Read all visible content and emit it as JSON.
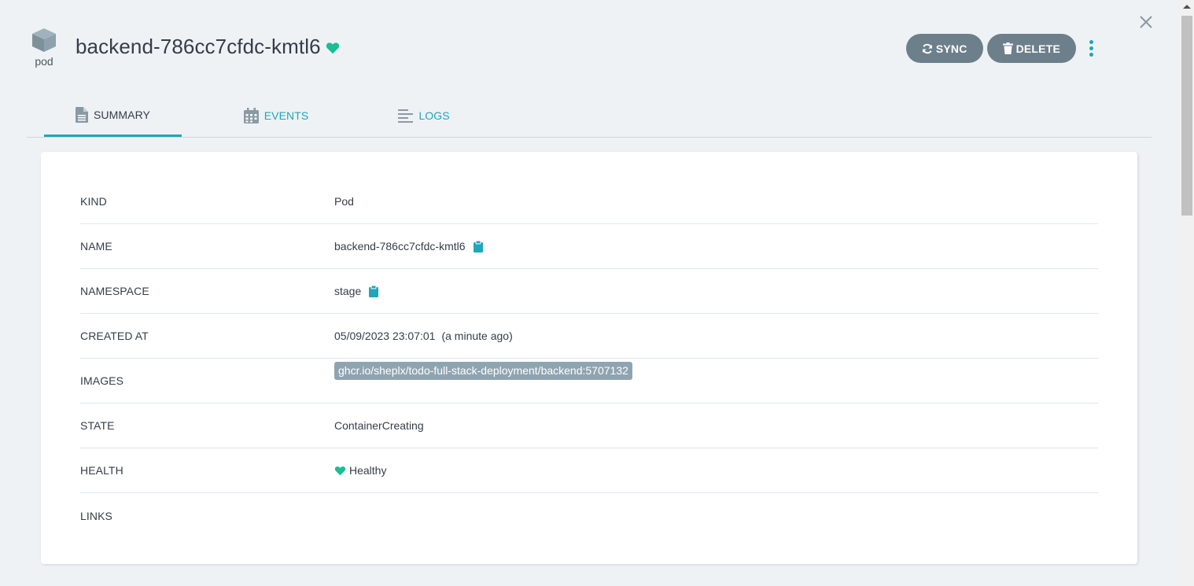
{
  "header": {
    "kind_icon": "cube-icon",
    "kind_label": "pod",
    "title": "backend-786cc7cfdc-kmtl6",
    "health_icon": "heart-icon",
    "health_color": "#18be94"
  },
  "actions": {
    "sync_label": "SYNC",
    "delete_label": "DELETE",
    "more_icon": "kebab-menu-icon"
  },
  "tabs": [
    {
      "label": "SUMMARY",
      "icon": "file-icon",
      "active": true
    },
    {
      "label": "EVENTS",
      "icon": "calendar-icon",
      "active": false
    },
    {
      "label": "LOGS",
      "icon": "align-left-icon",
      "active": false
    }
  ],
  "summary": {
    "kind": {
      "label": "KIND",
      "value": "Pod"
    },
    "name": {
      "label": "NAME",
      "value": "backend-786cc7cfdc-kmtl6"
    },
    "namespace": {
      "label": "NAMESPACE",
      "value": "stage"
    },
    "created_at": {
      "label": "CREATED AT",
      "value": "05/09/2023 23:07:01",
      "relative": "(a minute ago)"
    },
    "images": {
      "label": "IMAGES",
      "value": "ghcr.io/sheplx/todo-full-stack-deployment/backend:5707132"
    },
    "state": {
      "label": "STATE",
      "value": "ContainerCreating"
    },
    "health": {
      "label": "HEALTH",
      "value": "Healthy"
    },
    "links": {
      "label": "LINKS",
      "value": ""
    }
  },
  "colors": {
    "accent": "#21a5b8",
    "button_bg": "#6d7f8b",
    "healthy": "#18be94",
    "page_bg": "#eef2f5"
  }
}
